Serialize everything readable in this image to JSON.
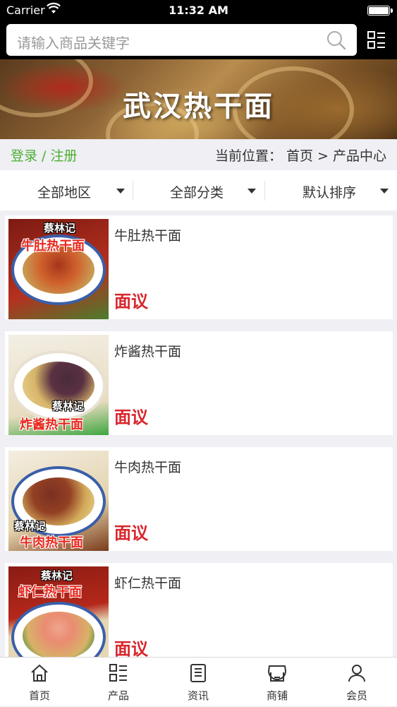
{
  "status_bar": {
    "carrier": "Carrier",
    "time": "11:32 AM"
  },
  "search": {
    "placeholder": "请输入商品关键字"
  },
  "banner": {
    "title": "武汉热干面"
  },
  "breadcrumb": {
    "login": "登录 / 注册",
    "location": "当前位置： 首页 > 产品中心"
  },
  "filters": [
    {
      "label": "全部地区"
    },
    {
      "label": "全部分类"
    },
    {
      "label": "默认排序"
    }
  ],
  "products": [
    {
      "name": "牛肚热干面",
      "price": "面议",
      "image_text": "牛肚热干面",
      "brand": "蔡林记"
    },
    {
      "name": "炸酱热干面",
      "price": "面议",
      "image_text": "炸酱热干面",
      "brand": "蔡林记"
    },
    {
      "name": "牛肉热干面",
      "price": "面议",
      "image_text": "牛肉热干面",
      "brand": "蔡林记"
    },
    {
      "name": "虾仁热干面",
      "price": "面议",
      "image_text": "虾仁热干面",
      "brand": "蔡林记"
    }
  ],
  "tabbar": [
    {
      "label": "首页",
      "icon": "home-icon"
    },
    {
      "label": "产品",
      "icon": "grid-list-icon"
    },
    {
      "label": "资讯",
      "icon": "news-icon"
    },
    {
      "label": "商铺",
      "icon": "store-icon"
    },
    {
      "label": "会员",
      "icon": "user-icon"
    }
  ],
  "colors": {
    "accent_green": "#4caf30",
    "price_red": "#d9262c",
    "header_black": "#000000"
  }
}
